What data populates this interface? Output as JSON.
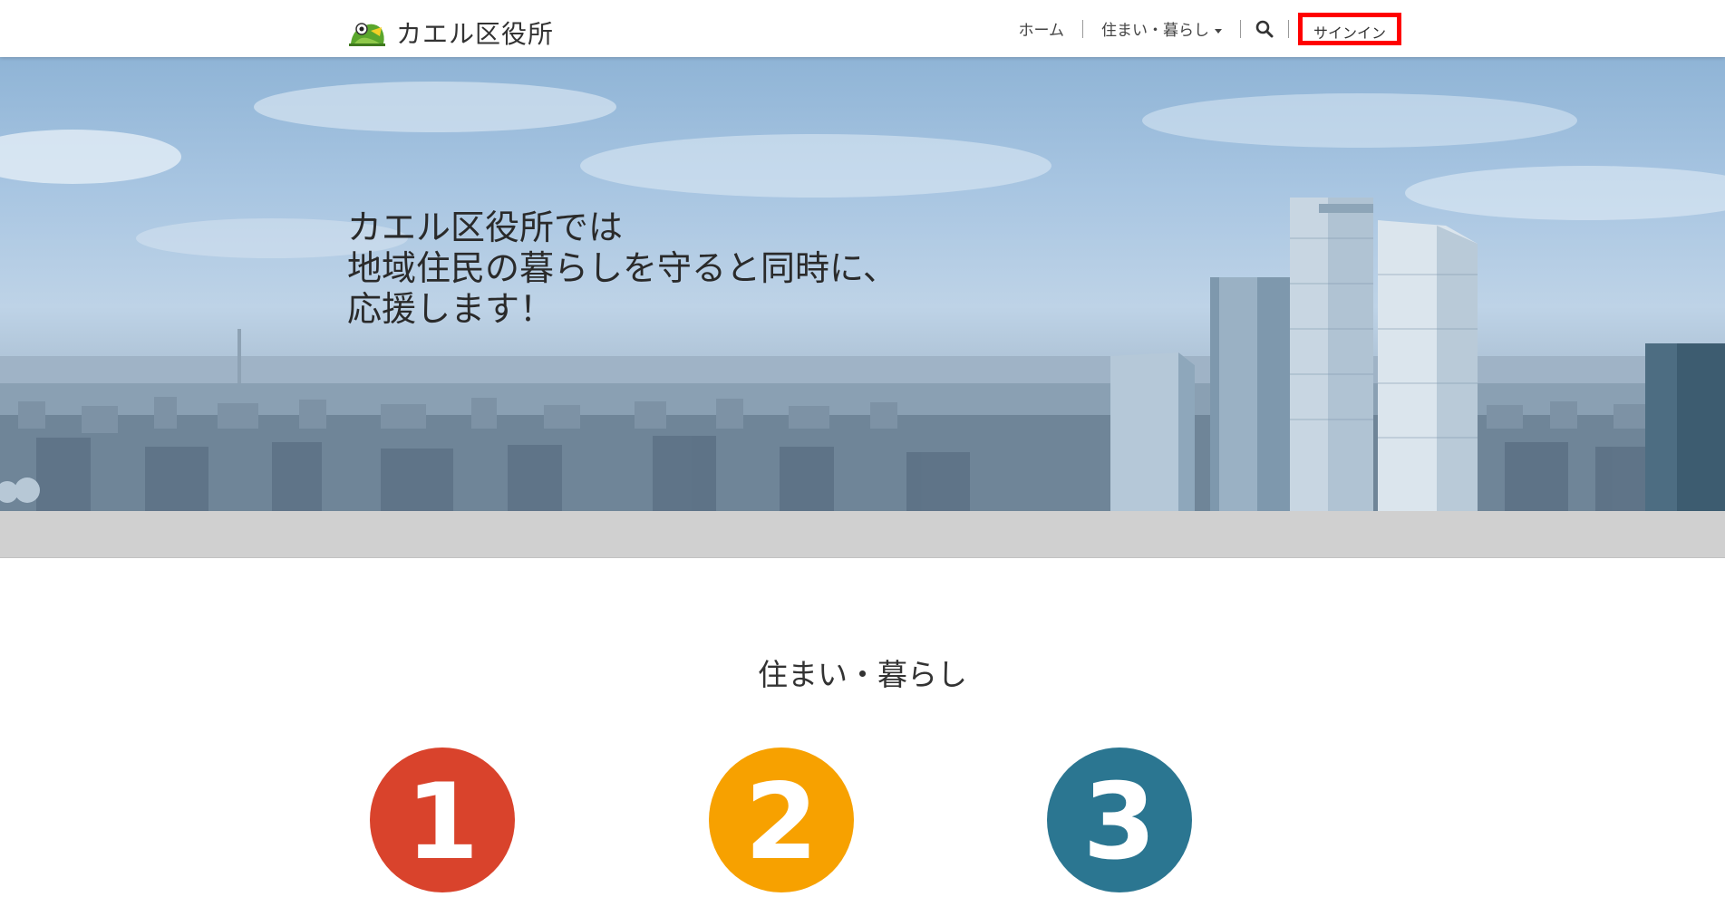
{
  "header": {
    "brand_name": "カエル区役所",
    "nav": {
      "home": "ホーム",
      "living": "住まい・暮らし",
      "signin": "サインイン"
    }
  },
  "hero": {
    "text": "カエル区役所では\n地域住民の暮らしを守ると同時に、\n応援します！"
  },
  "section": {
    "title": "住まい・暮らし",
    "steps": [
      {
        "number": "1",
        "color": "#d9432c"
      },
      {
        "number": "2",
        "color": "#f7a100"
      },
      {
        "number": "3",
        "color": "#2b7691"
      }
    ]
  },
  "icons": {
    "logo": "frog-logo-icon",
    "search": "search-icon",
    "dropdown": "caret-down-icon"
  }
}
